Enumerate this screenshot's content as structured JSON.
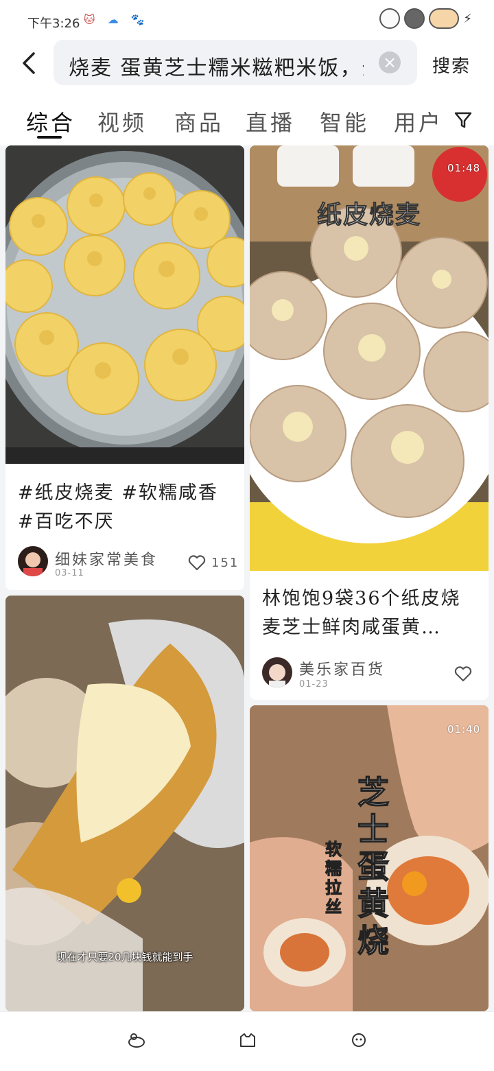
{
  "status_bar": {
    "time": "下午3:26",
    "left_icons": [
      "cat-face-icon",
      "cloud-icon",
      "paw-icon"
    ],
    "right_icons": [
      "cat-pet-icon",
      "dark-cat-pet-icon",
      "fish-pet-icon",
      "charging-bolt-icon"
    ]
  },
  "search": {
    "query": "烧麦 蛋黄芝士糯米糍粑米饭，蛋",
    "button_label": "搜索"
  },
  "tabs": [
    {
      "label": "综合",
      "active": true
    },
    {
      "label": "视频",
      "active": false
    },
    {
      "label": "商品",
      "active": false
    },
    {
      "label": "直播",
      "active": false
    },
    {
      "label": "智能",
      "active": false
    },
    {
      "label": "用户",
      "active": false
    }
  ],
  "cards": [
    {
      "caption": "#纸皮烧麦 #软糯咸香 #百吃不厌",
      "author": "细妹家常美食",
      "date": "03-11",
      "likes": "151"
    },
    {
      "duration": "01:48",
      "overlay_title": "纸皮烧麦",
      "caption": "林饱饱9袋36个纸皮烧麦芝士鲜肉咸蛋黄…",
      "author": "美乐家百货",
      "date": "01-23"
    },
    {
      "subtitle": "现在才只要20几块钱就能到手"
    },
    {
      "duration": "01:40",
      "overlay_big": "芝士蛋黄烧",
      "overlay_small": "软糯拉丝"
    }
  ],
  "colors": {
    "feed_background": "#f3f4f6",
    "search_background": "#f0f2f5",
    "steamer_metal": "#9aa3a8",
    "dumpling_yellow": "#f2d166",
    "dumpling_beige": "#d8c2a8"
  }
}
